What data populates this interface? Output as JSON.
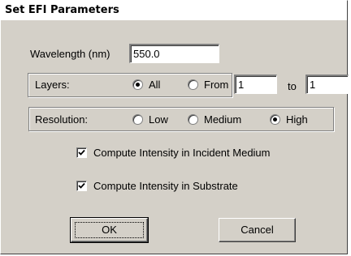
{
  "dialog": {
    "title": "Set EFI Parameters"
  },
  "wavelength": {
    "label": "Wavelength (nm)",
    "value": "550.0"
  },
  "layers": {
    "label": "Layers:",
    "all_label": "All",
    "from_label": "From",
    "to_label": "to",
    "from_value": "1",
    "to_value": "1",
    "selected": "All"
  },
  "resolution": {
    "label": "Resolution:",
    "options": [
      "Low",
      "Medium",
      "High"
    ],
    "selected": "High"
  },
  "options": {
    "incident_label": "Compute Intensity in Incident Medium",
    "incident_checked": true,
    "substrate_label": "Compute Intensity in Substrate",
    "substrate_checked": true
  },
  "buttons": {
    "ok_label": "OK",
    "cancel_label": "Cancel"
  }
}
